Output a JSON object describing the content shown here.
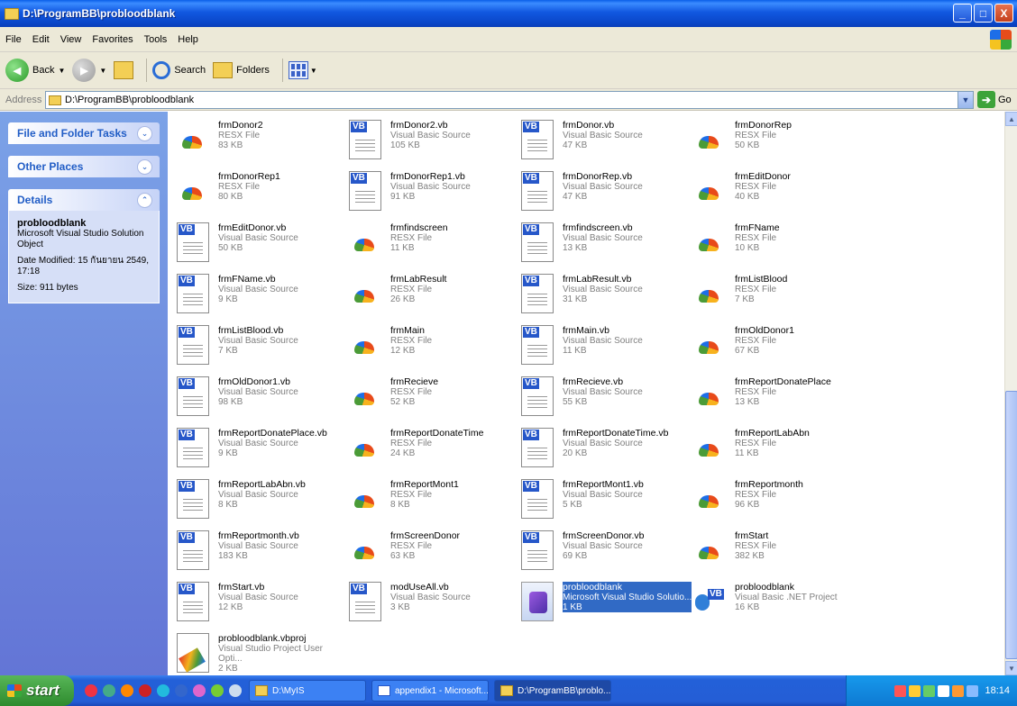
{
  "window": {
    "title": "D:\\ProgramBB\\probloodblank",
    "buttons": {
      "minimize": "_",
      "maximize": "□",
      "close": "X"
    }
  },
  "menu": [
    "File",
    "Edit",
    "View",
    "Favorites",
    "Tools",
    "Help"
  ],
  "toolbar": {
    "back_label": "Back",
    "search_label": "Search",
    "folders_label": "Folders"
  },
  "address": {
    "label": "Address",
    "value": "D:\\ProgramBB\\probloodblank",
    "go_label": "Go"
  },
  "sidebar": {
    "file_tasks": "File and Folder Tasks",
    "other_places": "Other Places",
    "details": "Details",
    "details_name": "probloodblank",
    "details_type": "Microsoft Visual Studio Solution Object",
    "details_modified": "Date Modified: 15 กันยายน 2549, 17:18",
    "details_size": "Size: 911 bytes"
  },
  "files": [
    {
      "name": "frmDonor2",
      "type": "RESX File",
      "size": "83 KB",
      "icon": "resx"
    },
    {
      "name": "frmDonor2.vb",
      "type": "Visual Basic Source",
      "size": "105 KB",
      "icon": "vb"
    },
    {
      "name": "frmDonor.vb",
      "type": "Visual Basic Source",
      "size": "47 KB",
      "icon": "vb"
    },
    {
      "name": "frmDonorRep",
      "type": "RESX File",
      "size": "50 KB",
      "icon": "resx"
    },
    {
      "name": "frmDonorRep1",
      "type": "RESX File",
      "size": "80 KB",
      "icon": "resx"
    },
    {
      "name": "frmDonorRep1.vb",
      "type": "Visual Basic Source",
      "size": "91 KB",
      "icon": "vb"
    },
    {
      "name": "frmDonorRep.vb",
      "type": "Visual Basic Source",
      "size": "47 KB",
      "icon": "vb"
    },
    {
      "name": "frmEditDonor",
      "type": "RESX File",
      "size": "40 KB",
      "icon": "resx"
    },
    {
      "name": "frmEditDonor.vb",
      "type": "Visual Basic Source",
      "size": "50 KB",
      "icon": "vb"
    },
    {
      "name": "frmfindscreen",
      "type": "RESX File",
      "size": "11 KB",
      "icon": "resx"
    },
    {
      "name": "frmfindscreen.vb",
      "type": "Visual Basic Source",
      "size": "13 KB",
      "icon": "vb"
    },
    {
      "name": "frmFName",
      "type": "RESX File",
      "size": "10 KB",
      "icon": "resx"
    },
    {
      "name": "frmFName.vb",
      "type": "Visual Basic Source",
      "size": "9 KB",
      "icon": "vb"
    },
    {
      "name": "frmLabResult",
      "type": "RESX File",
      "size": "26 KB",
      "icon": "resx"
    },
    {
      "name": "frmLabResult.vb",
      "type": "Visual Basic Source",
      "size": "31 KB",
      "icon": "vb"
    },
    {
      "name": "frmListBlood",
      "type": "RESX File",
      "size": "7 KB",
      "icon": "resx"
    },
    {
      "name": "frmListBlood.vb",
      "type": "Visual Basic Source",
      "size": "7 KB",
      "icon": "vb"
    },
    {
      "name": "frmMain",
      "type": "RESX File",
      "size": "12 KB",
      "icon": "resx"
    },
    {
      "name": "frmMain.vb",
      "type": "Visual Basic Source",
      "size": "11 KB",
      "icon": "vb"
    },
    {
      "name": "frmOldDonor1",
      "type": "RESX File",
      "size": "67 KB",
      "icon": "resx"
    },
    {
      "name": "frmOldDonor1.vb",
      "type": "Visual Basic Source",
      "size": "98 KB",
      "icon": "vb"
    },
    {
      "name": "frmRecieve",
      "type": "RESX File",
      "size": "52 KB",
      "icon": "resx"
    },
    {
      "name": "frmRecieve.vb",
      "type": "Visual Basic Source",
      "size": "55 KB",
      "icon": "vb"
    },
    {
      "name": "frmReportDonatePlace",
      "type": "RESX File",
      "size": "13 KB",
      "icon": "resx"
    },
    {
      "name": "frmReportDonatePlace.vb",
      "type": "Visual Basic Source",
      "size": "9 KB",
      "icon": "vb"
    },
    {
      "name": "frmReportDonateTime",
      "type": "RESX File",
      "size": "24 KB",
      "icon": "resx"
    },
    {
      "name": "frmReportDonateTime.vb",
      "type": "Visual Basic Source",
      "size": "20 KB",
      "icon": "vb"
    },
    {
      "name": "frmReportLabAbn",
      "type": "RESX File",
      "size": "11 KB",
      "icon": "resx"
    },
    {
      "name": "frmReportLabAbn.vb",
      "type": "Visual Basic Source",
      "size": "8 KB",
      "icon": "vb"
    },
    {
      "name": "frmReportMont1",
      "type": "RESX File",
      "size": "8 KB",
      "icon": "resx"
    },
    {
      "name": "frmReportMont1.vb",
      "type": "Visual Basic Source",
      "size": "5 KB",
      "icon": "vb"
    },
    {
      "name": "frmReportmonth",
      "type": "RESX File",
      "size": "96 KB",
      "icon": "resx"
    },
    {
      "name": "frmReportmonth.vb",
      "type": "Visual Basic Source",
      "size": "183 KB",
      "icon": "vb"
    },
    {
      "name": "frmScreenDonor",
      "type": "RESX File",
      "size": "63 KB",
      "icon": "resx"
    },
    {
      "name": "frmScreenDonor.vb",
      "type": "Visual Basic Source",
      "size": "69 KB",
      "icon": "vb"
    },
    {
      "name": "frmStart",
      "type": "RESX File",
      "size": "382 KB",
      "icon": "resx"
    },
    {
      "name": "frmStart.vb",
      "type": "Visual Basic Source",
      "size": "12 KB",
      "icon": "vb"
    },
    {
      "name": "modUseAll.vb",
      "type": "Visual Basic Source",
      "size": "3 KB",
      "icon": "vb"
    },
    {
      "name": "probloodblank",
      "type": "Microsoft Visual Studio Solutio...",
      "size": "1 KB",
      "icon": "sln",
      "selected": true
    },
    {
      "name": "probloodblank",
      "type": "Visual Basic .NET Project",
      "size": "16 KB",
      "icon": "vbproj"
    },
    {
      "name": "probloodblank.vbproj",
      "type": "Visual Studio Project User Opti...",
      "size": "2 KB",
      "icon": "user"
    }
  ],
  "taskbar": {
    "start_label": "start",
    "tasks": [
      {
        "label": "D:\\MyIS",
        "icon": "folder"
      },
      {
        "label": "appendix1 - Microsoft...",
        "icon": "doc"
      },
      {
        "label": "D:\\ProgramBB\\problo...",
        "icon": "folder",
        "active": true
      }
    ],
    "clock": "18:14"
  }
}
